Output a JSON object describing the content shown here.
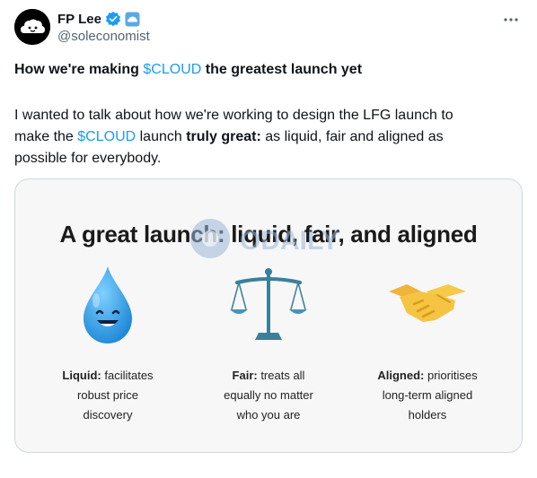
{
  "author": {
    "display_name": "FP Lee",
    "handle": "@soleconomist",
    "verified_color": "#1d9bf0",
    "affiliate_badge_color": "#5aa9e6"
  },
  "icons": {
    "avatar": "cloud-face-icon",
    "verified": "verified-badge-icon",
    "affiliate": "cloud-affiliate-icon",
    "more": "more-horizontal-icon"
  },
  "post": {
    "title_prefix": "How we're making ",
    "title_cashtag": "$CLOUD",
    "title_suffix": " the greatest launch yet",
    "body_line1": "I wanted to talk about how we're working to design the LFG launch to",
    "body_make": "make the ",
    "body_cashtag": "$CLOUD",
    "body_launch": " launch ",
    "body_bold": "truly great:",
    "body_rest": " as liquid, fair and aligned as",
    "body_line3": "possible for everybody."
  },
  "media": {
    "title": "A great launch: liquid, fair, and aligned",
    "watermark": "ODAILY",
    "columns": [
      {
        "icon": "smiling-droplet-icon",
        "bold": "Liquid:",
        "rest": " facilitates",
        "line2": "robust price",
        "line3": "discovery"
      },
      {
        "icon": "balance-scale-icon",
        "bold": "Fair:",
        "rest": " treats all",
        "line2": "equally no matter",
        "line3": "who you are"
      },
      {
        "icon": "handshake-icon",
        "bold": "Aligned:",
        "rest": " prioritises",
        "line2": "long-term aligned",
        "line3": "holders"
      }
    ]
  },
  "colors": {
    "link": "#1d9bf0",
    "secondary_text": "#536471",
    "card_border": "#cfd9de"
  }
}
